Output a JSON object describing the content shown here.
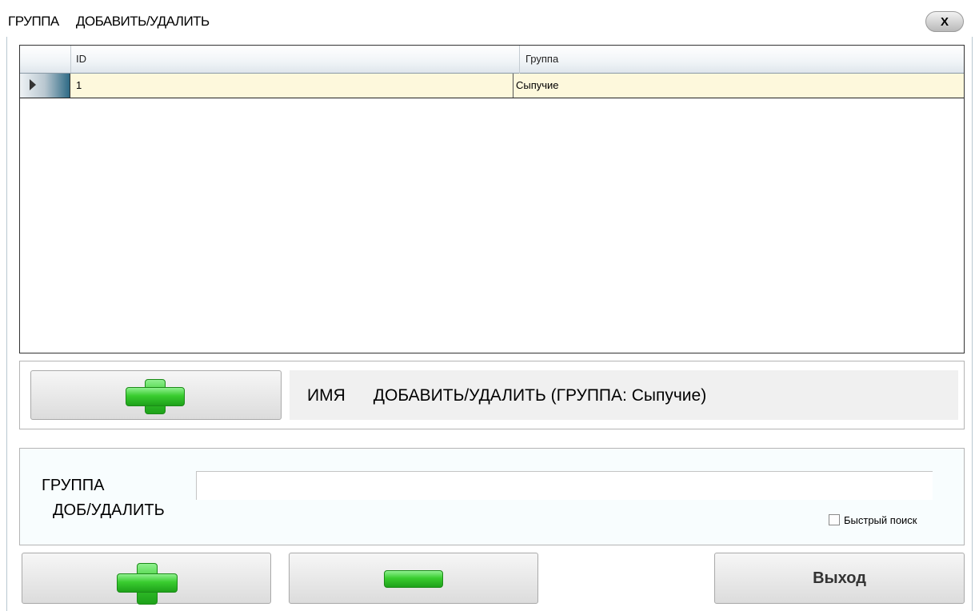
{
  "window": {
    "title": "ГРУППА     ДОБАВИТЬ/УДАЛИТЬ",
    "close_label": "X"
  },
  "grid": {
    "columns": [
      "ID",
      "Группа"
    ],
    "rows": [
      {
        "id": "1",
        "group": "Сыпучие",
        "selected": true
      }
    ]
  },
  "name_section": {
    "label": "ИМЯ      ДОБАВИТЬ/УДАЛИТЬ (ГРУППА: Сыпучие)",
    "add_icon": "plus-icon"
  },
  "form": {
    "label_line1": "ГРУППА",
    "label_line2": "ДОБ/УДАЛИТЬ",
    "input_value": "",
    "quick_search_label": "Быстрый поиск",
    "quick_search_checked": false
  },
  "actions": {
    "add_icon": "plus-icon",
    "remove_icon": "minus-icon",
    "exit_label": "Выход"
  },
  "colors": {
    "accent_green": "#39cc2f",
    "selected_row": "#fdf8dc"
  }
}
